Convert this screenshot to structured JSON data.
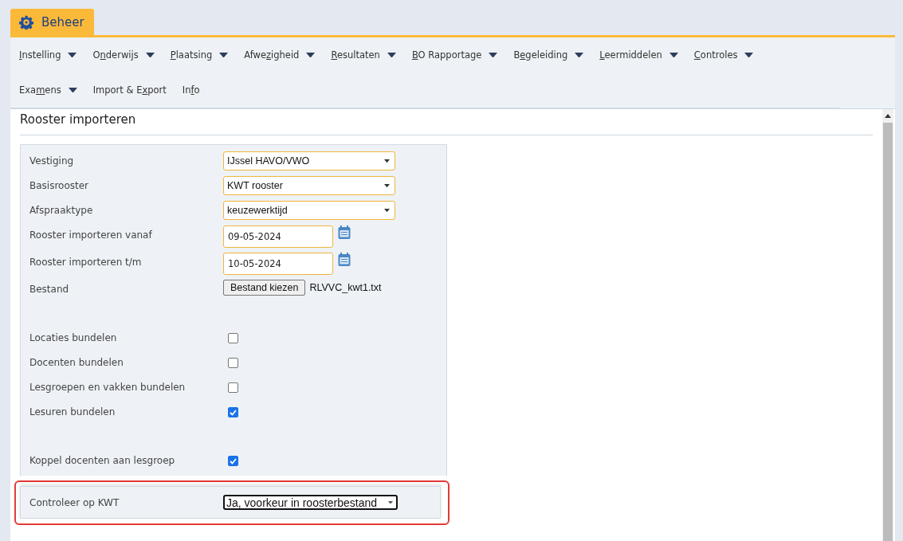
{
  "module_tab": {
    "label": "Beheer",
    "selected": true
  },
  "menu": [
    {
      "key": "I",
      "post": "nstelling",
      "dropdown": true
    },
    {
      "pre": "O",
      "key": "n",
      "post": "derwijs",
      "dropdown": true
    },
    {
      "key": "P",
      "post": "laatsing",
      "dropdown": true
    },
    {
      "pre": "Afwe",
      "key": "z",
      "post": "igheid",
      "dropdown": true
    },
    {
      "key": "R",
      "post": "esultaten",
      "dropdown": true
    },
    {
      "key": "B",
      "post": "O Rapportage",
      "dropdown": true
    },
    {
      "pre": "B",
      "key": "e",
      "post": "geleiding",
      "dropdown": true
    },
    {
      "key": "L",
      "post": "eermiddelen",
      "dropdown": true
    },
    {
      "key": "C",
      "post": "ontroles",
      "dropdown": true
    },
    {
      "pre": "Exa",
      "key": "m",
      "post": "ens",
      "dropdown": true
    },
    {
      "pre": "Import & E",
      "key": "x",
      "post": "port",
      "dropdown": false
    },
    {
      "pre": "In",
      "key": "f",
      "post": "o",
      "dropdown": false
    }
  ],
  "page_title": "Rooster importeren",
  "form": [
    {
      "kind": "select",
      "label": "Vestiging",
      "value": "IJssel HAVO/VWO"
    },
    {
      "kind": "select",
      "label": "Basisrooster",
      "value": "KWT rooster"
    },
    {
      "kind": "select",
      "label": "Afspraaktype",
      "value": "keuzewerktijd"
    },
    {
      "kind": "date",
      "label": "Rooster importeren vanaf",
      "value": "09-05-2024"
    },
    {
      "kind": "date",
      "label": "Rooster importeren t/m",
      "value": "10-05-2024"
    },
    {
      "kind": "file",
      "label": "Bestand",
      "button": "Bestand kiezen",
      "value": "RLVVC_kwt1.txt"
    },
    {
      "kind": "spacer"
    },
    {
      "kind": "checkbox",
      "label": "Locaties bundelen",
      "checked": false
    },
    {
      "kind": "checkbox",
      "label": "Docenten bundelen",
      "checked": false
    },
    {
      "kind": "checkbox",
      "label": "Lesgroepen en vakken bundelen",
      "checked": false
    },
    {
      "kind": "checkbox",
      "label": "Lesuren bundelen",
      "checked": true
    },
    {
      "kind": "spacer"
    },
    {
      "kind": "checkbox",
      "label": "Koppel docenten aan lesgroep",
      "checked": true
    }
  ],
  "highlighted_row": {
    "label": "Controleer op KWT",
    "value": "Ja, voorkeur in roosterbestand",
    "focused": true
  }
}
